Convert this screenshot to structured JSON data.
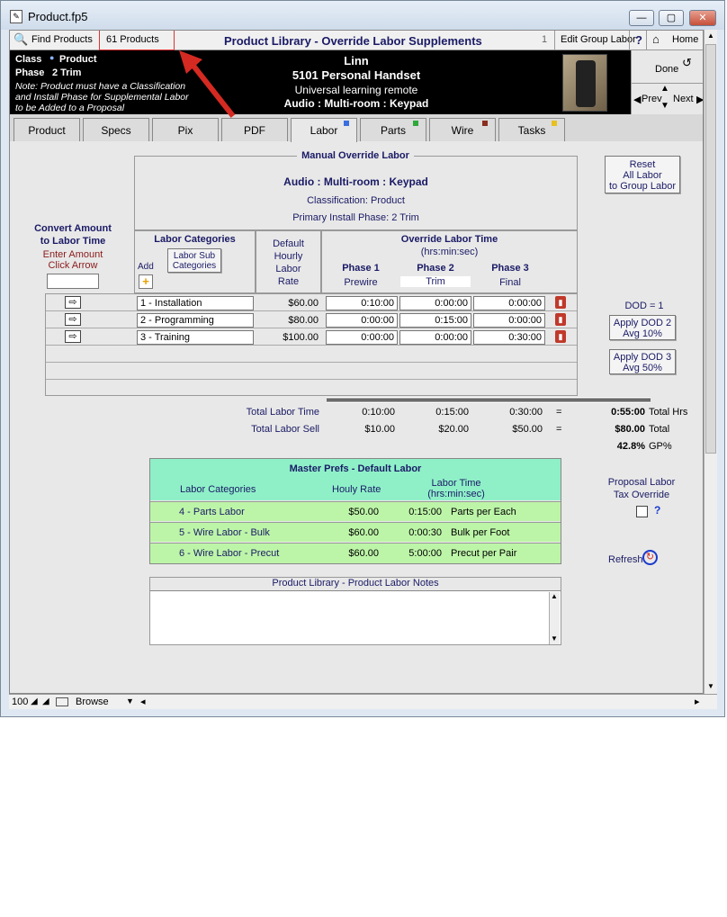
{
  "window": {
    "title": "Product.fp5"
  },
  "toolbar": {
    "find_products": "Find Products",
    "product_count": "61 Products",
    "title": "Product Library - Override Labor Supplements",
    "record_num": "1",
    "edit_group_labor": "Edit Group Labor",
    "help": "?",
    "home": "Home"
  },
  "header": {
    "class_label": "Class",
    "class_value": "Product",
    "phase_label": "Phase",
    "phase_value": "2 Trim",
    "note_line1": "Note: Product must have a Classification",
    "note_line2": "and Install Phase for Supplemental Labor",
    "note_line3": "to be Added to a Proposal",
    "manufacturer": "Linn",
    "model": "5101 Personal Handset",
    "description": "Universal learning remote",
    "category": "Audio : Multi-room : Keypad"
  },
  "nav": {
    "done": "Done",
    "prev": "Prev",
    "next": "Next"
  },
  "tabs": [
    {
      "label": "Product",
      "dot": ""
    },
    {
      "label": "Specs",
      "dot": ""
    },
    {
      "label": "Pix",
      "dot": ""
    },
    {
      "label": "PDF",
      "dot": ""
    },
    {
      "label": "Labor",
      "dot": "#3a6fe0"
    },
    {
      "label": "Parts",
      "dot": "#2fa83a"
    },
    {
      "label": "Wire",
      "dot": "#8a2e1e"
    },
    {
      "label": "Tasks",
      "dot": "#e8c020"
    }
  ],
  "labor": {
    "section_title": "Manual Override Labor",
    "category": "Audio : Multi-room : Keypad",
    "classification": "Classification: Product",
    "primary_phase": "Primary Install Phase: 2 Trim",
    "reset_btn": "Reset\nAll Labor\nto Group Labor",
    "convert_title1": "Convert Amount",
    "convert_title2": "to Labor Time",
    "enter_amount": "Enter Amount",
    "click_arrow": "Click Arrow",
    "labor_categories": "Labor Categories",
    "add": "Add",
    "sub_categories_btn": "Labor Sub\nCategories",
    "default_rate_h1": "Default",
    "default_rate_h2": "Hourly",
    "default_rate_h3": "Labor",
    "default_rate_h4": "Rate",
    "override_title": "Override Labor Time",
    "override_sub": "(hrs:min:sec)",
    "phase_headers": [
      "Phase 1",
      "Phase 2",
      "Phase 3"
    ],
    "phase_names": [
      "Prewire",
      "Trim",
      "Final"
    ],
    "rows": [
      {
        "category": "1 - Installation",
        "rate": "$60.00",
        "p1": "0:10:00",
        "p2": "0:00:00",
        "p3": "0:00:00"
      },
      {
        "category": "2 - Programming",
        "rate": "$80.00",
        "p1": "0:00:00",
        "p2": "0:15:00",
        "p3": "0:00:00"
      },
      {
        "category": "3 - Training",
        "rate": "$100.00",
        "p1": "0:00:00",
        "p2": "0:00:00",
        "p3": "0:30:00"
      }
    ],
    "dod": "DOD = 1",
    "apply_dod2": "Apply DOD 2\nAvg 10%",
    "apply_dod3": "Apply DOD 3\nAvg 50%",
    "total_time_label": "Total Labor Time",
    "total_time": [
      "0:10:00",
      "0:15:00",
      "0:30:00"
    ],
    "total_sell_label": "Total Labor Sell",
    "total_sell": [
      "$10.00",
      "$20.00",
      "$50.00"
    ],
    "eq": "=",
    "total_hrs": "0:55:00",
    "total_hrs_label": "Total Hrs",
    "total": "$80.00",
    "total_label": "Total",
    "gp": "42.8%",
    "gp_label": "GP%"
  },
  "master": {
    "title": "Master Prefs - Default Labor",
    "col_cat": "Labor Categories",
    "col_rate": "Houly Rate",
    "col_time1": "Labor Time",
    "col_time2": "(hrs:min:sec)",
    "rows": [
      {
        "cat": "4 - Parts Labor",
        "rate": "$50.00",
        "time": "0:15:00",
        "unit": "Parts per Each"
      },
      {
        "cat": "5 - Wire Labor - Bulk",
        "rate": "$60.00",
        "time": "0:00:30",
        "unit": "Bulk per Foot"
      },
      {
        "cat": "6 - Wire Labor - Precut",
        "rate": "$60.00",
        "time": "5:00:00",
        "unit": "Precut per Pair"
      }
    ]
  },
  "tax": {
    "line1": "Proposal Labor",
    "line2": "Tax Override",
    "help": "?",
    "refresh": "Refresh"
  },
  "notes": {
    "title": "Product Library  - Product Labor Notes",
    "text": ""
  },
  "status": {
    "zoom": "100",
    "mode": "Browse"
  }
}
